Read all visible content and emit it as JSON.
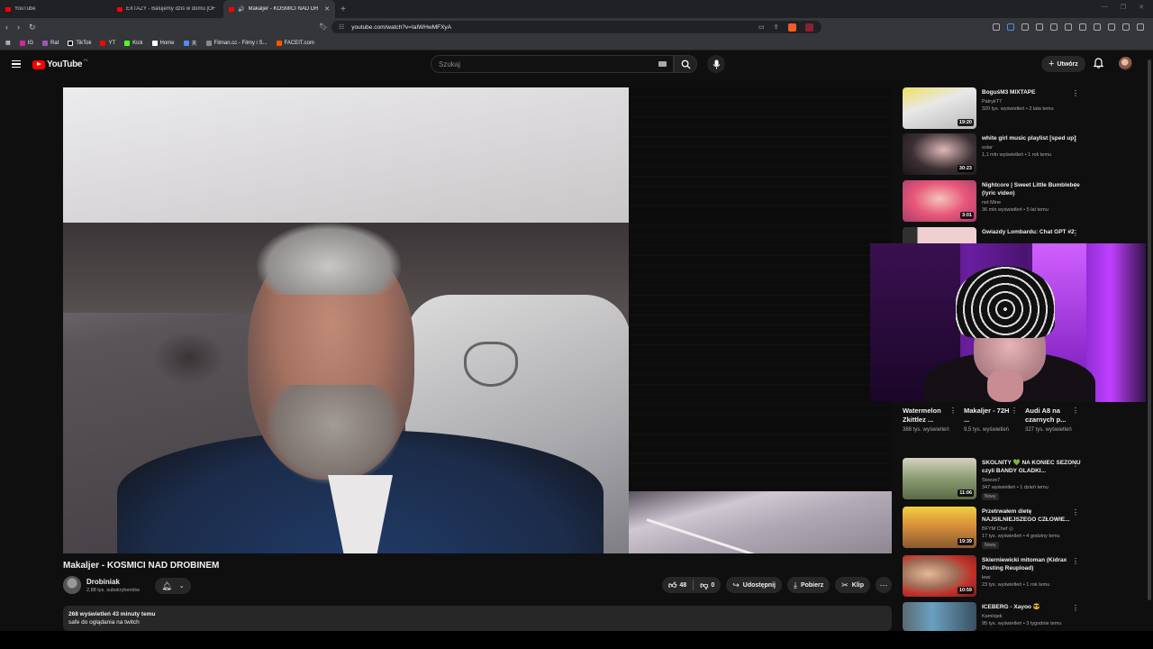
{
  "browser": {
    "tabs": [
      {
        "label": "YouTube",
        "active": false
      },
      {
        "label": "EXTAZY - Balujemy dziś w domu [OF",
        "active": false
      },
      {
        "label": "Makaljer - KOSMICI NAD DR",
        "active": true
      }
    ],
    "url": "youtube.com/watch?v=IaIWHwMFXyA",
    "bookmarks": [
      "IG",
      "Rat",
      "TikTok",
      "YT",
      "Kick",
      "Home",
      "天",
      "Filman.cc - Filmy i S...",
      "FACEIT.com"
    ]
  },
  "header": {
    "logo_text": "YouTube",
    "logo_country": "PL",
    "search_placeholder": "Szukaj",
    "create_label": "Utwórz"
  },
  "video": {
    "title": "Makaljer - KOSMICI NAD DROBINEM",
    "channel_name": "Drobiniak",
    "subscribers": "2,88 tys. subskrybentów",
    "likes": "48",
    "dislikes": "0",
    "share_label": "Udostępnij",
    "download_label": "Pobierz",
    "clip_label": "Klip",
    "description_stats": "268 wyświetleń  43 minuty temu",
    "description_text": "safe do oglądania na twitch"
  },
  "sidebar": {
    "top_videos": [
      {
        "title": "BoguśM3 MIXTAPE",
        "channel": "PatrykT7",
        "views": "320 tys. wyświetleń • 2 lata temu",
        "duration": "19:20",
        "thumb": "#8a8a88"
      },
      {
        "title": "white girl music playlist [sped up]",
        "channel": "solar",
        "views": "1,1 mln wyświetleń • 1 rok temu",
        "duration": "30:23",
        "thumb": "#2a2326"
      },
      {
        "title": "Nightcore | Sweet Little Bumblebee (lyric video)",
        "channel": "not Mine",
        "views": "36 mln wyświetleń • 5 lat temu",
        "duration": "3:01",
        "thumb": "#e8587a"
      },
      {
        "title": "Gwiazdy Lombardu: Chat GPT #2",
        "channel": "",
        "views": "",
        "duration": "",
        "thumb": "#e9c7c9"
      }
    ],
    "shorts": [
      {
        "title": "Watermelon Zkittlez ...",
        "views": "388 tys. wyświetleń"
      },
      {
        "title": "Makaljer - 72H ...",
        "views": "9,5 tys. wyświetleń"
      },
      {
        "title": "Audi A8 na czarnych p...",
        "views": "327 tys. wyświetleń"
      }
    ],
    "bottom_videos": [
      {
        "title": "SKOLNITY 💚 NA KONIEC SEZONU czyli BANDY GLADKI...",
        "channel": "Steeze7",
        "views": "347 wyświetleń • 1 dzień temu",
        "duration": "11:06",
        "badge": "Nowy",
        "thumb": "#8a9a70"
      },
      {
        "title": "Przetrwałem dietę NAJSILNIEJSZEGO CZŁOWIE...",
        "channel": "BFYM Chef ◎",
        "views": "17 tys. wyświetleń • 4 godziny temu",
        "duration": "19:39",
        "badge": "Nowy",
        "thumb": "#d8903a"
      },
      {
        "title": "Skierniewicki mitoman (Kidrax Posting Reupload)",
        "channel": "lewi",
        "views": "23 tys. wyświetleń • 1 rok temu",
        "duration": "10:59",
        "badge": "",
        "thumb": "#c0312a"
      },
      {
        "title": "ICEBERG - Xayoo 😎",
        "channel": "Kamiiqek",
        "views": "95 tys. wyświetleń • 3 tygodnie temu",
        "duration": "",
        "badge": "",
        "thumb": "#6aa0c0"
      }
    ]
  }
}
